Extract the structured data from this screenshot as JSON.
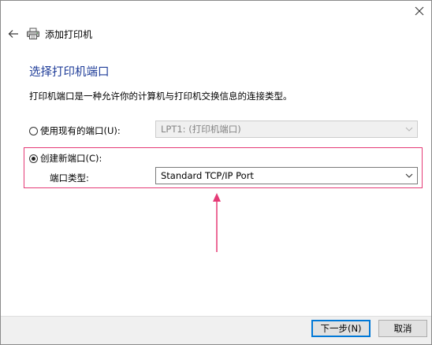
{
  "nav": {
    "title": "添加打印机"
  },
  "page": {
    "heading": "选择打印机端口",
    "description": "打印机端口是一种允许你的计算机与打印机交换信息的连接类型。"
  },
  "options": {
    "existing_port": {
      "label": "使用现有的端口(U):",
      "selected": false,
      "value": "LPT1: (打印机端口)"
    },
    "new_port": {
      "label": "创建新端口(C):",
      "selected": true,
      "type_label": "端口类型:",
      "type_value": "Standard TCP/IP Port"
    }
  },
  "buttons": {
    "next": "下一步(N)",
    "cancel": "取消"
  },
  "colors": {
    "heading": "#1f3d99",
    "highlight": "#e53a76",
    "primary_border": "#0078d7"
  }
}
